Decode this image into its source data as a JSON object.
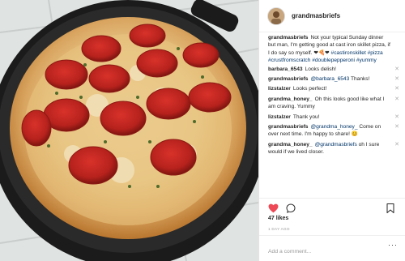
{
  "post": {
    "username": "grandmasbriefs",
    "caption": {
      "user": "grandmasbriefs",
      "text": "Not your typical Sunday dinner but man, I'm getting good at cast iron skillet pizza, if I do say so myself. ❤🍕❤",
      "hashtags": "#castironskillet #pizza #crustfromscratch #doublepepperoni #yummy"
    },
    "comments": [
      {
        "user": "barbara_6543",
        "text": "Looks delish!"
      },
      {
        "user": "grandmasbriefs",
        "mention": "@barbara_6543",
        "text": "Thanks!"
      },
      {
        "user": "lizstalzer",
        "text": "Looks perfect!"
      },
      {
        "user": "grandma_honey_",
        "text": "Oh this looks good like what I am craving. Yummy"
      },
      {
        "user": "lizstalzer",
        "text": "Thank you!"
      },
      {
        "user": "grandmasbriefs",
        "mention": "@grandma_honey_",
        "text": "Come on over next time. I'm happy to share! 😊"
      },
      {
        "user": "grandma_honey_",
        "mention": "@grandmasbriefs",
        "text": "oh I sure would if we lived closer."
      }
    ],
    "delete_glyph": "✕",
    "likes": "47 likes",
    "time_ago": "1 DAY AGO",
    "add_comment_placeholder": "Add a comment...",
    "more_glyph": "···"
  },
  "icons": {
    "heart": "heart-icon",
    "comment": "comment-icon",
    "bookmark": "bookmark-icon",
    "more": "more-options-icon"
  },
  "colors": {
    "heart": "#ed4956",
    "link": "#003569",
    "text": "#262626",
    "muted": "#999999"
  }
}
